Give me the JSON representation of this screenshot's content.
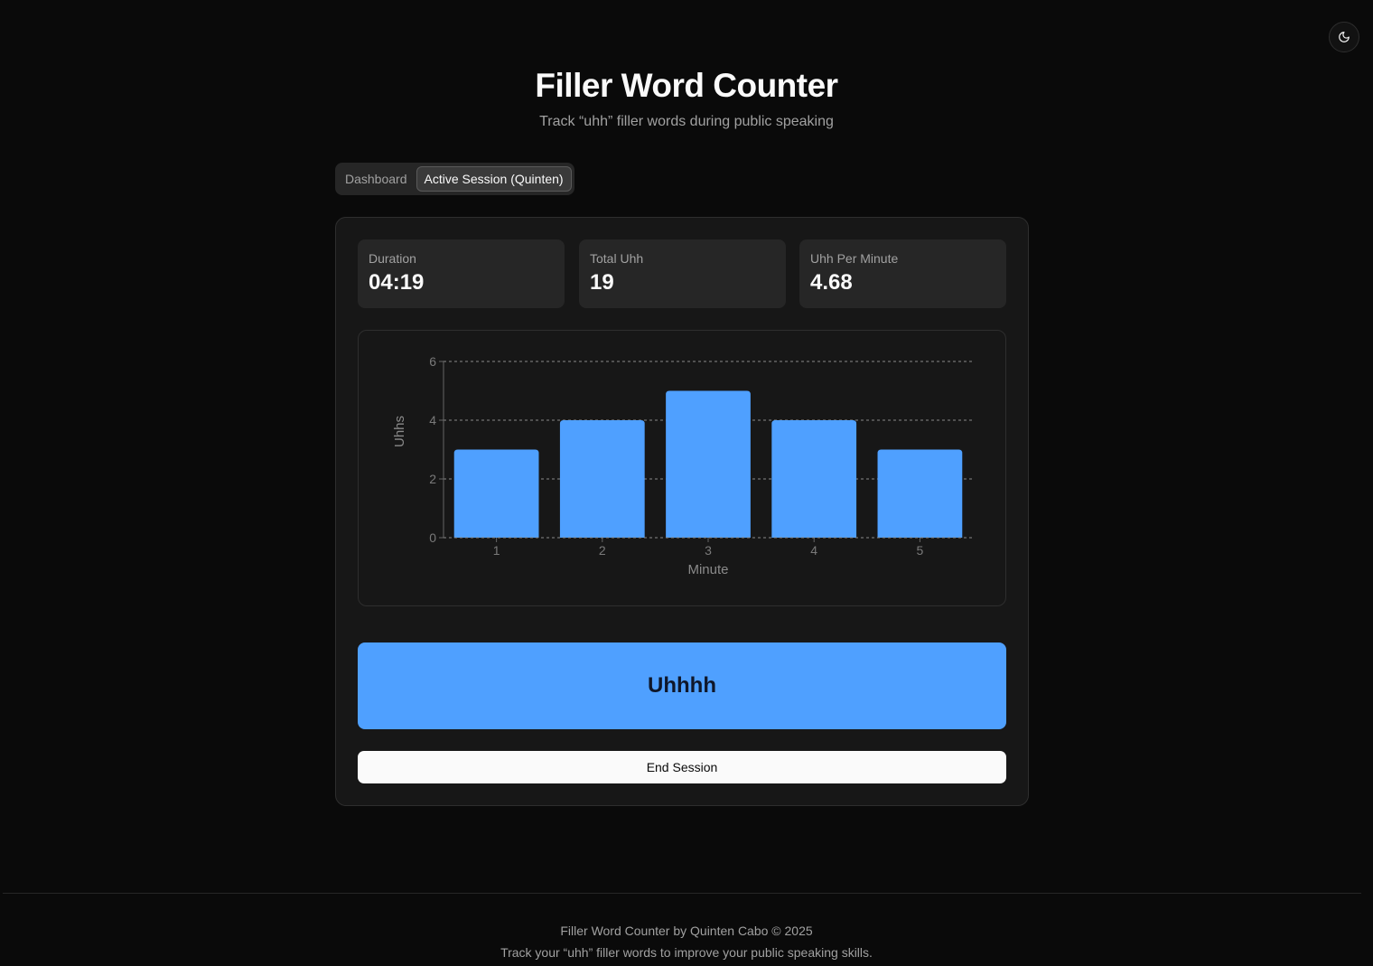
{
  "header": {
    "title": "Filler Word Counter",
    "subtitle": "Track “uhh” filler words during public speaking"
  },
  "theme_toggle": {
    "icon": "moon-icon"
  },
  "tabs": [
    {
      "label": "Dashboard",
      "active": false
    },
    {
      "label": "Active Session (Quinten)",
      "active": true
    }
  ],
  "stats": [
    {
      "label": "Duration",
      "value": "04:19"
    },
    {
      "label": "Total Uhh",
      "value": "19"
    },
    {
      "label": "Uhh Per Minute",
      "value": "4.68"
    }
  ],
  "chart_data": {
    "type": "bar",
    "categories": [
      "1",
      "2",
      "3",
      "4",
      "5"
    ],
    "values": [
      3,
      4,
      5,
      4,
      3
    ],
    "xlabel": "Minute",
    "ylabel": "Uhhs",
    "ylim": [
      0,
      6
    ],
    "yticks": [
      "0",
      "2",
      "4",
      "6"
    ],
    "grid": true,
    "bar_color": "#4fa0ff"
  },
  "actions": {
    "uhh_label": "Uhhhh",
    "end_label": "End Session"
  },
  "footer": {
    "credit": "Filler Word Counter by Quinten Cabo © 2025",
    "tagline": "Track your “uhh” filler words to improve your public speaking skills."
  },
  "colors": {
    "background": "#0a0a0a",
    "card": "#171717",
    "accent": "#4fa0ff"
  }
}
